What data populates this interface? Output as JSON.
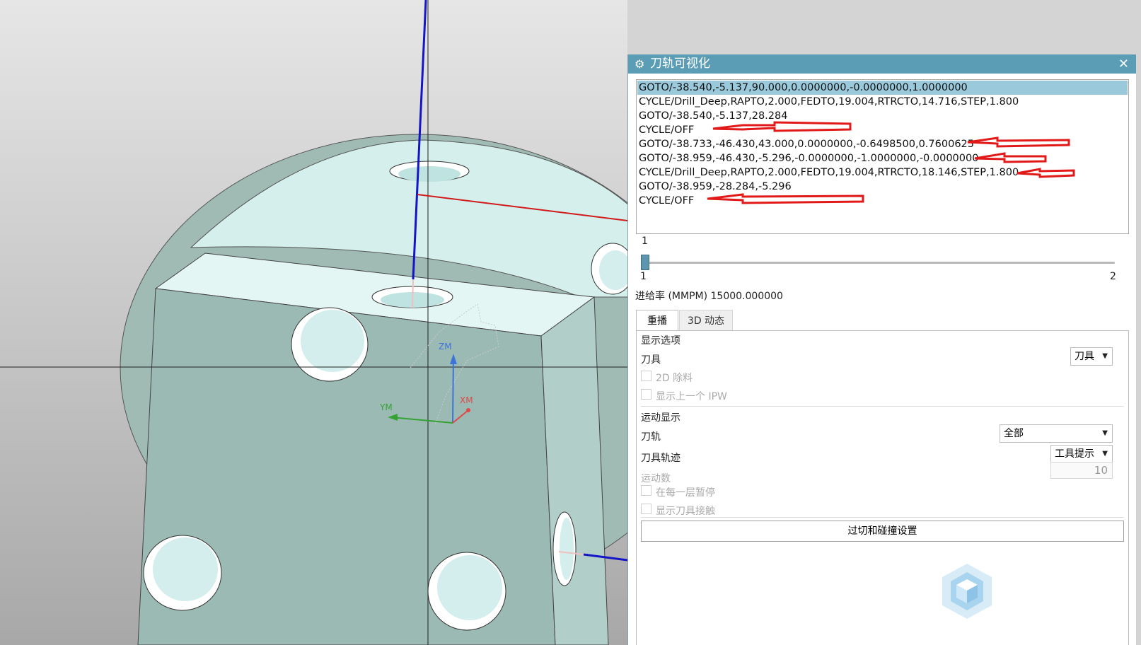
{
  "dialog": {
    "title": "刀轨可视化",
    "close_glyph": "✕",
    "gear_glyph": "⚙"
  },
  "code_lines": [
    "GOTO/-38.540,-5.137,90.000,0.0000000,-0.0000000,1.0000000",
    "CYCLE/Drill_Deep,RAPTO,2.000,FEDTO,19.004,RTRCTO,14.716,STEP,1.800",
    "GOTO/-38.540,-5.137,28.284",
    "CYCLE/OFF",
    "GOTO/-38.733,-46.430,43.000,0.0000000,-0.6498500,0.7600625",
    "GOTO/-38.959,-46.430,-5.296,-0.0000000,-1.0000000,-0.0000000",
    "CYCLE/Drill_Deep,RAPTO,2.000,FEDTO,19.004,RTRCTO,18.146,STEP,1.800",
    "GOTO/-38.959,-28.284,-5.296",
    "CYCLE/OFF"
  ],
  "slider": {
    "current": "1",
    "min": "1",
    "max": "2",
    "position_fraction": 0
  },
  "feed_rate": "进给率 (MMPM) 15000.000000",
  "tabs": [
    "重播",
    "3D 动态"
  ],
  "display_options": {
    "header": "显示选项",
    "tool_label": "刀具",
    "tool_value": "刀具",
    "remove_2d": "2D 除料",
    "show_prev_ipw": "显示上一个 IPW"
  },
  "motion_display": {
    "header": "运动显示",
    "toolpath_label": "刀轨",
    "toolpath_value": "全部",
    "tool_trace_label": "刀具轨迹",
    "tool_trace_value": "工具提示",
    "motion_count_label": "运动数",
    "motion_count_value": "10",
    "pause_each_layer": "在每一层暂停",
    "show_tool_contact": "显示刀具接触"
  },
  "gouge_button": "过切和碰撞设置",
  "axes": {
    "z": "ZM",
    "y": "YM",
    "x": "XM"
  },
  "colors": {
    "titlebar": "#5a9db5",
    "selection": "#9bc9dc",
    "part_face": "#9fbdb6",
    "part_top": "#d6f2ef",
    "annotation_arrow": "#e11919"
  }
}
